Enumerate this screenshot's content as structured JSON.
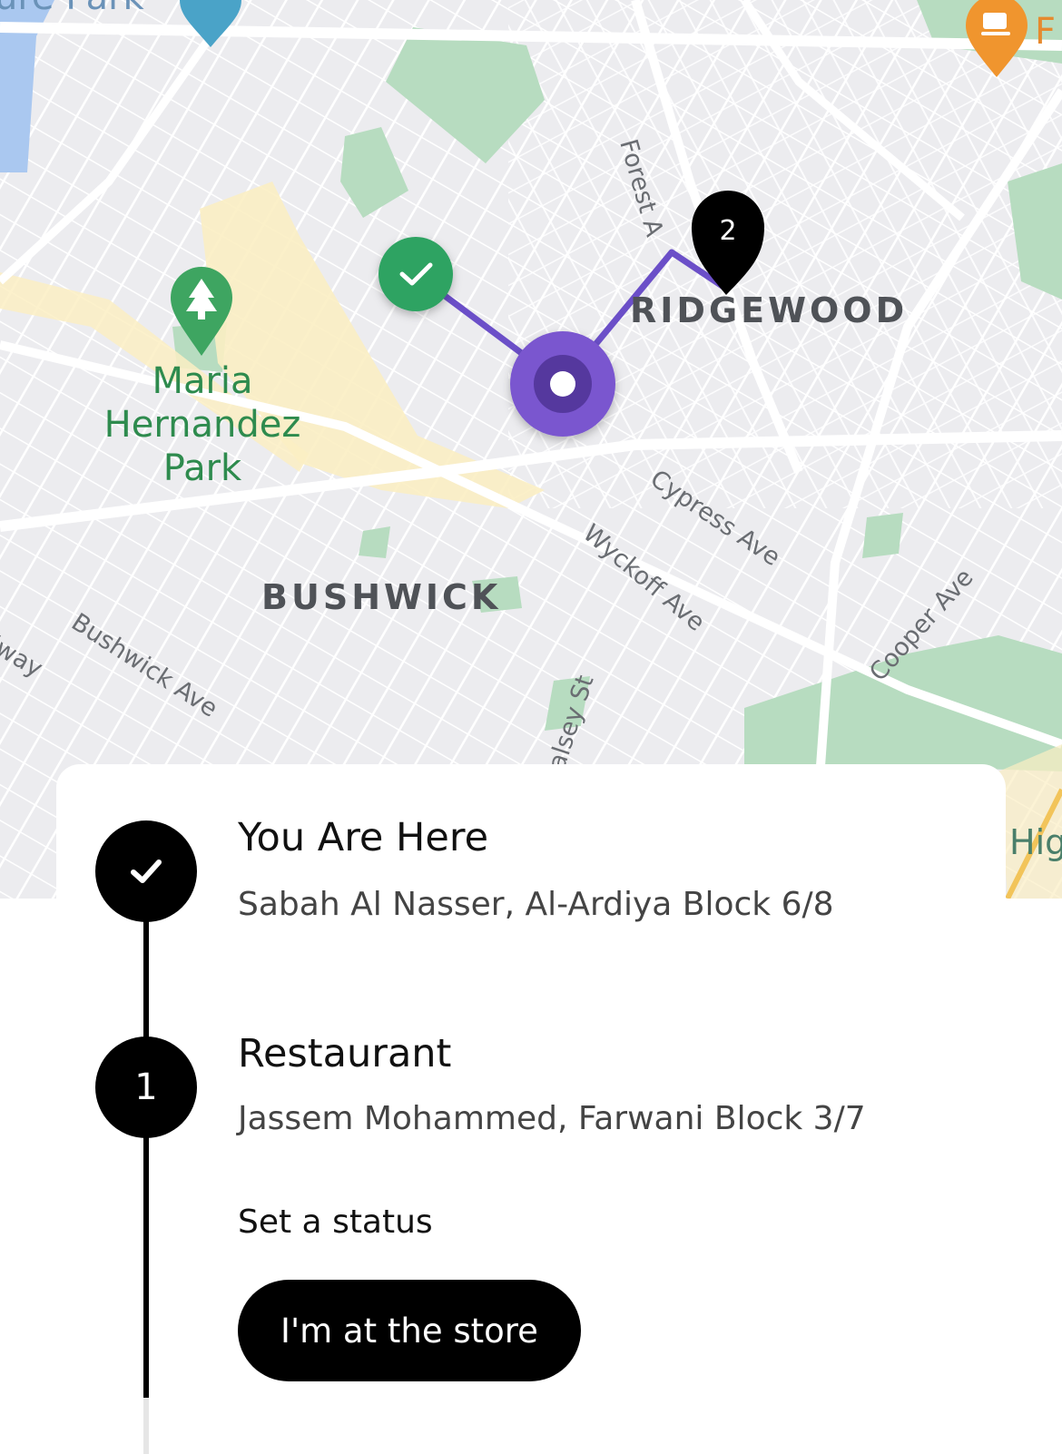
{
  "map": {
    "labels": {
      "top_park_partial": "ure Park",
      "cafe_partial": "F",
      "street_forest": "Forest A",
      "neighborhood_ridgewood": "RIDGEWOOD",
      "park_name_line1": "Maria",
      "park_name_line2": "Hernandez",
      "park_name_line3": "Park",
      "street_cypress": "Cypress Ave",
      "street_wyckoff": "Wyckoff Ave",
      "neighborhood_bushwick": "BUSHWICK",
      "street_bushwick": "Bushwick Ave",
      "street_broadway_partial": "dway",
      "street_cooper": "Cooper Ave",
      "street_halsey": "alsey St",
      "highway_partial": "Hig"
    },
    "markers": {
      "completed_label": "✓",
      "destination_label": "2"
    },
    "colors": {
      "route": "#6b4fc8",
      "current_marker": "#7a57cf",
      "current_marker_inner": "#55389e",
      "completed_marker": "#2ea362",
      "destination_marker": "#000000",
      "park": "#b7dcc0",
      "road": "#ffffff",
      "highlight_road": "#fbeec3"
    }
  },
  "sheet": {
    "steps": [
      {
        "icon": "check-icon",
        "title": "You Are Here",
        "subtitle": "Sabah Al Nasser, Al-Ardiya Block 6/8"
      },
      {
        "number": "1",
        "title": "Restaurant",
        "subtitle": "Jassem Mohammed, Farwani Block 3/7",
        "status_label": "Set a status",
        "status_button": "I'm at the store"
      }
    ]
  }
}
